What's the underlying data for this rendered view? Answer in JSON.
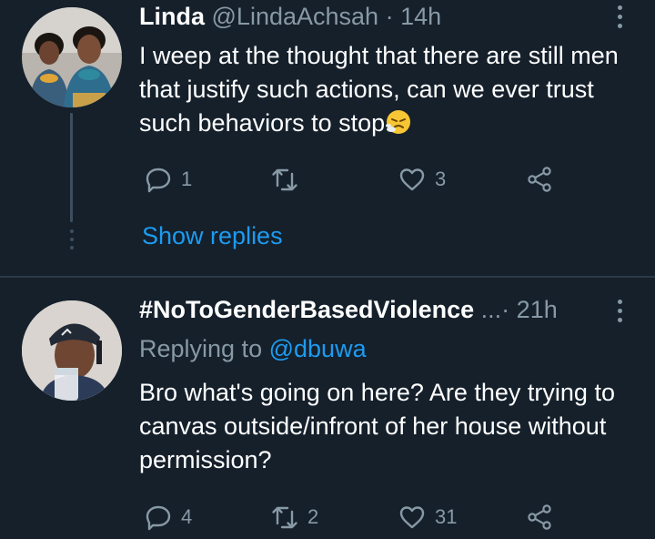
{
  "tweets": [
    {
      "name": "Linda",
      "handle": "@LindaAchsah",
      "dot": "·",
      "time": "14h",
      "text": "I weep at the thought that there are still men that justify such actions, can we ever trust such behaviors to stop",
      "replies": "1",
      "retweets": "",
      "likes": "3",
      "show_replies": "Show replies"
    },
    {
      "name": "#NoToGenderBasedViolence",
      "ellipsis": "...",
      "dot": "·",
      "time": "21h",
      "replying_prefix": "Replying to",
      "replying_to": "@dbuwa",
      "text": "Bro what's going on here? Are they trying to canvas outside/infront of her house without permission?",
      "replies": "4",
      "retweets": "2",
      "likes": "31"
    }
  ],
  "colors": {
    "background": "#15202b",
    "secondary_text": "#8899a6",
    "link": "#1d9bf0"
  }
}
